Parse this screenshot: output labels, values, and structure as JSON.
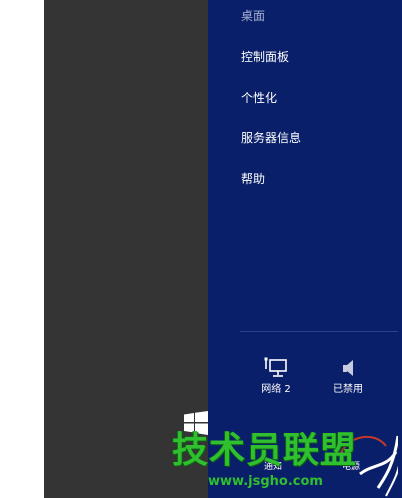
{
  "settings_menu": {
    "items": [
      {
        "label": "桌面"
      },
      {
        "label": "控制面板"
      },
      {
        "label": "个性化"
      },
      {
        "label": "服务器信息"
      },
      {
        "label": "帮助"
      }
    ]
  },
  "quick_settings": {
    "network": {
      "label": "网络 2",
      "icon": "network-monitor-icon"
    },
    "volume": {
      "label": "已禁用",
      "icon": "speaker-icon"
    }
  },
  "bottom_row": {
    "notifications_label": "通知",
    "power_label": "电源"
  },
  "watermark": {
    "title": "技术员联盟",
    "url": "www.jsgho.com"
  },
  "colors": {
    "panel_bg": "#0a1f6a",
    "desktop_bg": "#343434",
    "watermark_green": "#2fbf2f"
  }
}
